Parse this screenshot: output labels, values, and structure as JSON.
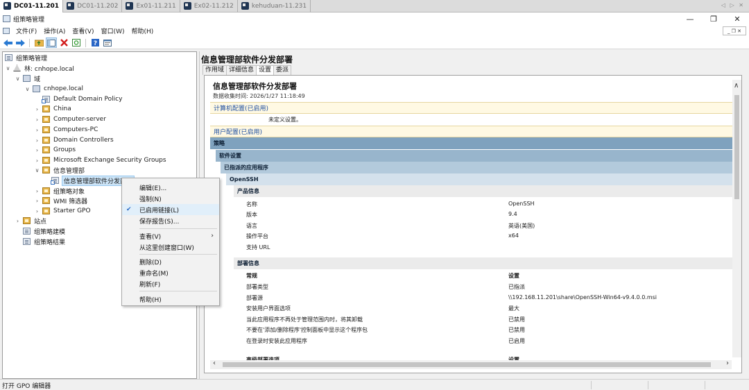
{
  "vm_tabs": [
    {
      "label": "DC01-11.201",
      "active": true
    },
    {
      "label": "DC01-11.202",
      "active": false
    },
    {
      "label": "Ex01-11.211",
      "active": false
    },
    {
      "label": "Ex02-11.212",
      "active": false
    },
    {
      "label": "kehuduan-11.231",
      "active": false
    }
  ],
  "vm_nav": "◁ ▷ ✕",
  "window": {
    "title": "组策略管理",
    "minimize": "—",
    "restore": "❐",
    "close": "✕"
  },
  "menu": {
    "items": [
      "文件(F)",
      "操作(A)",
      "查看(V)",
      "窗口(W)",
      "帮助(H)"
    ],
    "mdi_controls": "_ ❐ ✕"
  },
  "toolbar": {
    "icons": [
      "back-icon",
      "forward-icon",
      "up-folder-icon",
      "show-hide-tree-icon",
      "delete-icon",
      "refresh-icon",
      "help-icon",
      "properties-icon"
    ]
  },
  "tree": {
    "root": "组策略管理",
    "forest": "林: cnhope.local",
    "domains": "域",
    "domain": "cnhope.local",
    "default_policy": "Default Domain Policy",
    "ous": [
      "China",
      "Computer-server",
      "Computers-PC",
      "Domain Controllers",
      "Groups",
      "Microsoft Exchange Security Groups"
    ],
    "info_ou": "信息管理部",
    "selected_gpo": "信息管理部软件分发部署",
    "gpo_objects": "组策略对象",
    "wmi": "WMI 筛选器",
    "starter": "Starter GPO",
    "sites": "站点",
    "modeling": "组策略建模",
    "results": "组策略结果"
  },
  "context_menu": {
    "edit": "编辑(E)...",
    "enforce": "强制(N)",
    "link_enabled": "已启用链接(L)",
    "link_check": "✔",
    "save_report": "保存报告(S)...",
    "view": "查看(V)",
    "view_arrow": "›",
    "new_window": "从这里创建窗口(W)",
    "delete": "删除(D)",
    "rename": "重命名(M)",
    "refresh": "刷新(F)",
    "help": "帮助(H)"
  },
  "right": {
    "title": "信息管理部软件分发部署",
    "tabs": [
      "作用域",
      "详细信息",
      "设置",
      "委派"
    ],
    "active_tab": 2
  },
  "report": {
    "title": "信息管理部软件分发部署",
    "date": "数据收集时间: 2026/1/27 11:18:49",
    "computer_config": "计算机配置(已启用)",
    "undefined": "未定义设置。",
    "user_config": "用户配置(已启用)",
    "policies": "策略",
    "software_settings": "软件设置",
    "assigned_apps": "已指派的应用程序",
    "app_name": "OpenSSH",
    "product_info": "产品信息",
    "product_rows": [
      {
        "key": "名称",
        "value": "OpenSSH"
      },
      {
        "key": "版本",
        "value": "9.4"
      },
      {
        "key": "语言",
        "value": "英语(美国)"
      },
      {
        "key": "操作平台",
        "value": "x64"
      },
      {
        "key": "支持 URL",
        "value": ""
      }
    ],
    "deploy_info": "部署信息",
    "deploy_header": {
      "key": "常规",
      "value": "设置"
    },
    "deploy_rows": [
      {
        "key": "部署类型",
        "value": "已指派"
      },
      {
        "key": "部署源",
        "value": "\\\\192.168.11.201\\share\\OpenSSH-Win64-v9.4.0.0.msi"
      },
      {
        "key": "安装用户界面选项",
        "value": "最大"
      },
      {
        "key": "当此应用程序不再处于管理范围内时，将其卸载",
        "value": "已禁用"
      },
      {
        "key": "不要在'添加/删除程序'控制面板中显示这个程序包",
        "value": "已禁用"
      },
      {
        "key": "在登录时安装此应用程序",
        "value": "已启用"
      }
    ],
    "advanced": {
      "key": "高级部署选项",
      "value": "设置"
    }
  },
  "status": {
    "text": "打开 GPO 编辑器"
  }
}
